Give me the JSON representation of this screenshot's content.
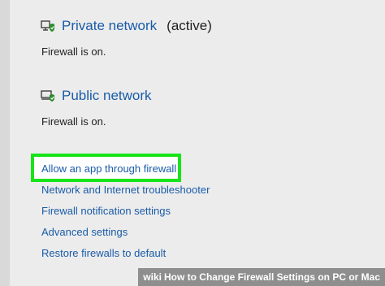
{
  "private_network": {
    "title": "Private network",
    "active_label": "(active)",
    "status": "Firewall is on.",
    "icon": "private-network-shield-icon"
  },
  "public_network": {
    "title": "Public network",
    "status": "Firewall is on.",
    "icon": "public-network-shield-icon"
  },
  "links": [
    "Allow an app through firewall",
    "Network and Internet troubleshooter",
    "Firewall notification settings",
    "Advanced settings",
    "Restore firewalls to default"
  ],
  "highlight_color": "#18e418",
  "link_color": "#1a5ca8",
  "footer": {
    "brand": "wiki",
    "text": "How to Change Firewall Settings on PC or Mac"
  }
}
